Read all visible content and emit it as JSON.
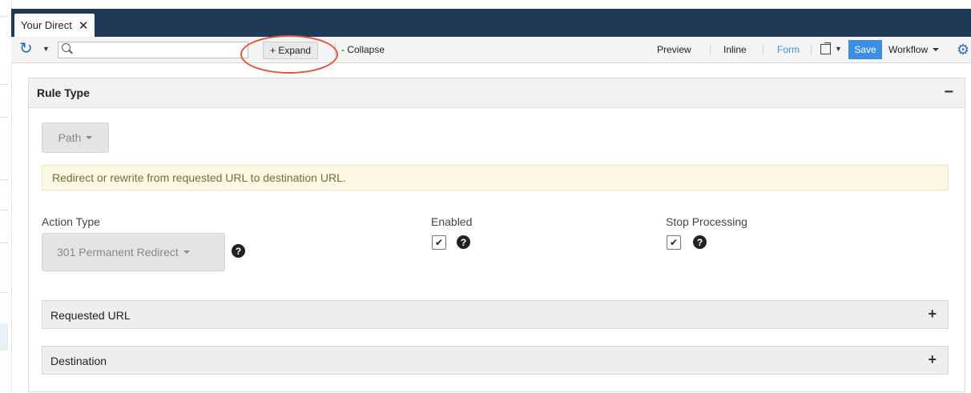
{
  "tab": {
    "title": "Your Direct",
    "close_icon": "close-icon"
  },
  "toolbar": {
    "search_placeholder": "",
    "expand_label": "+ Expand",
    "collapse_label": "- Collapse",
    "preview_label": "Preview",
    "inline_label": "Inline",
    "form_label": "Form",
    "save_label": "Save",
    "workflow_label": "Workflow",
    "icons": [
      "refresh-icon",
      "search-icon",
      "external-link-icon",
      "gear-icon"
    ]
  },
  "panel": {
    "title": "Rule Type",
    "toggle": "−",
    "path_label": "Path",
    "info_text": "Redirect or rewrite from requested URL to destination URL.",
    "action_type": {
      "label": "Action Type",
      "value": "301 Permanent Redirect"
    },
    "enabled": {
      "label": "Enabled",
      "checked": true
    },
    "stop_processing": {
      "label": "Stop Processing",
      "checked": true
    },
    "help_glyph": "?",
    "sub_panels": [
      {
        "title": "Requested URL",
        "toggle": "+"
      },
      {
        "title": "Destination",
        "toggle": "+"
      }
    ]
  },
  "colors": {
    "tabbar": "#1f3a57",
    "accent": "#3d8ee0",
    "annotation": "#e0543d",
    "info_bg": "#fcf8e3"
  }
}
